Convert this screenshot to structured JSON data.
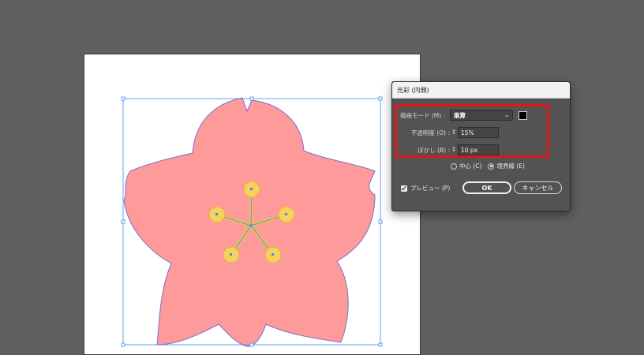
{
  "dialog": {
    "title": "光彩 (内側)",
    "blend_mode_label": "描画モード (M) :",
    "blend_mode_value": "乗算",
    "opacity_label": "不透明度 (O) :",
    "opacity_value": "15%",
    "blur_label": "ぼかし (B) :",
    "blur_value": "10 px",
    "center_label": "中心 (C)",
    "edge_label": "境界線 (E)",
    "selected_option": "edge",
    "preview_label": "プレビュー (P)",
    "preview_checked": true,
    "ok_label": "OK",
    "cancel_label": "キャンセル"
  },
  "colors": {
    "canvas_background": "#5f5f5f",
    "artboard": "#ffffff",
    "petal_fill": "#ff9a9a",
    "stamen_fill": "#f7d060",
    "selection": "#3a8ee6",
    "highlight": "#e5141b",
    "glow_color": "#000000"
  }
}
